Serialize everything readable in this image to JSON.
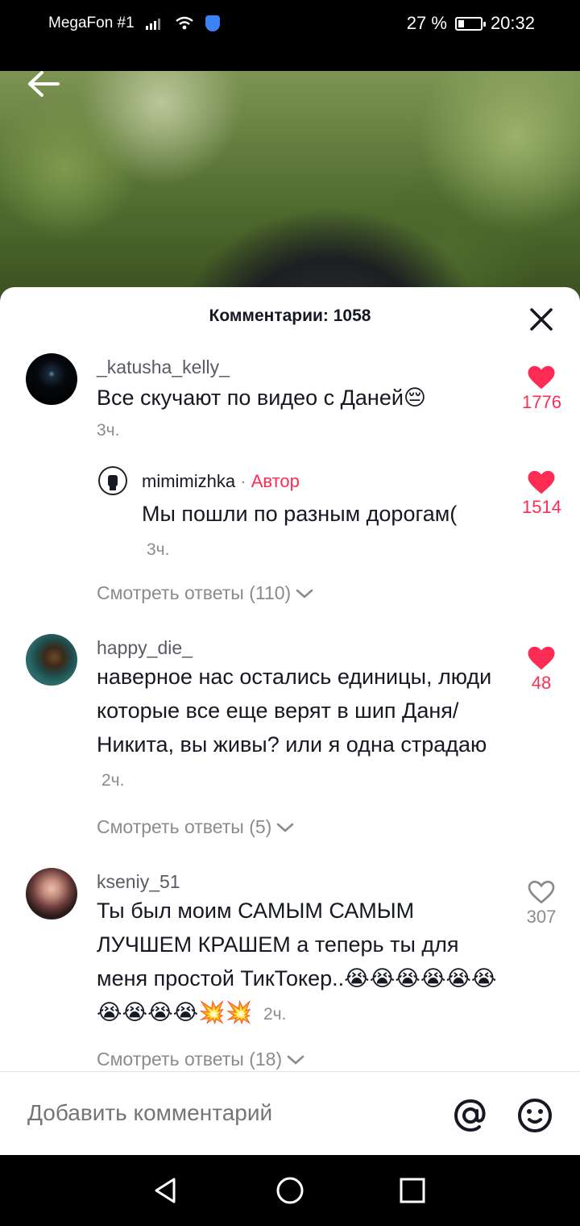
{
  "status_bar": {
    "carrier": "MegaFon #1",
    "battery": "27 %",
    "battery_level": 0.27,
    "time": "20:32"
  },
  "sheet": {
    "title": "Комментарии: 1058",
    "input_placeholder": "Добавить комментарий"
  },
  "comments": [
    {
      "username": "_katusha_kelly_",
      "text": "Все скучают по видео с Даней😔",
      "time": "3ч.",
      "likes": "1776",
      "liked": true,
      "reply": {
        "username": "mimimizhka",
        "separator": " · ",
        "author_tag": "Автор",
        "text": "Мы пошли по разным дорогам(",
        "time": "3ч.",
        "likes": "1514",
        "liked": true
      },
      "view_replies": "Смотреть ответы (110)"
    },
    {
      "username": "happy_die_",
      "text": "наверное нас остались единицы, люди которые все еще верят в шип Даня/Никита, вы живы? или я одна страдаю",
      "time": "2ч.",
      "likes": "48",
      "liked": true,
      "view_replies": "Смотреть ответы (5)"
    },
    {
      "username": "kseniy_51",
      "text": "Ты был моим САМЫМ САМЫМ ЛУЧШЕМ КРАШЕМ а теперь ты для меня простой ТикТокер..😭😭😭😭😭😭😭😭😭😭💥💥",
      "time": "2ч.",
      "likes": "307",
      "liked": false,
      "view_replies": "Смотреть ответы (18)"
    }
  ],
  "colors": {
    "accent": "#fe2c55",
    "text": "#161823",
    "muted": "#8a8b91"
  },
  "icons": [
    "back-arrow-icon",
    "close-icon",
    "heart-icon",
    "chevron-down-icon",
    "at-icon",
    "emoji-icon",
    "nav-back-icon",
    "nav-home-icon",
    "nav-recents-icon"
  ]
}
